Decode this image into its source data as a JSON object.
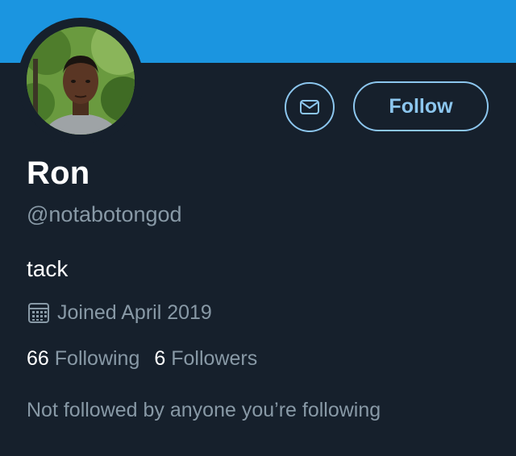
{
  "profile": {
    "name": "Ron",
    "handle": "@notabotongod",
    "bio": "tack",
    "joined": "Joined April 2019",
    "following_count": "66",
    "following_label": "Following",
    "followers_count": "6",
    "followers_label": "Followers",
    "followed_by": "Not followed by anyone you’re following"
  },
  "actions": {
    "follow_label": "Follow",
    "message_icon": "envelope-icon"
  },
  "icons": {
    "calendar": "calendar-icon"
  },
  "colors": {
    "banner": "#1b95e0",
    "background": "#16202c",
    "accent": "#8cc6ee",
    "secondary_text": "#8899a6"
  }
}
